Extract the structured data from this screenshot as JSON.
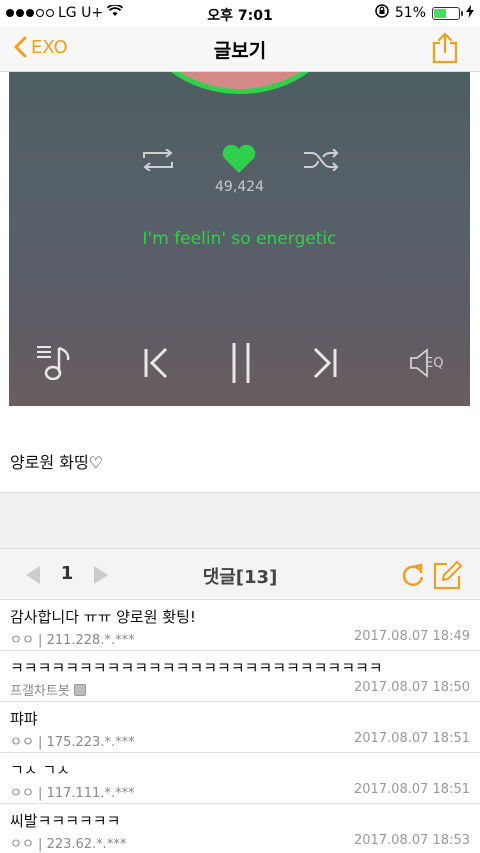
{
  "status_bar": {
    "carrier": "LG U+",
    "time": "오후 7:01",
    "battery": "51%",
    "battery_level": 0.51
  },
  "nav": {
    "back_label": "EXO",
    "title": "글보기"
  },
  "player": {
    "like_count": "49,424",
    "lyric": "I'm feelin' so energetic",
    "eq_label": "EQ"
  },
  "post": {
    "text": "양로원 화띵♡"
  },
  "comments_header": {
    "page": "1",
    "title": "댓글[13]"
  },
  "comments": [
    {
      "text": "감사합니다 ㅠㅠ 양로원 홧팅!",
      "author": "ㅇㅇ | 211.228.*.***",
      "date": "2017.08.07 18:49",
      "badge": false
    },
    {
      "text": "ㅋㅋㅋㅋㅋㅋㅋㅋㅋㅋㅋㅋㅋㅋㅋㅋㅋㅋㅋㅋㅋㅋㅋㅋㅋㅋㅋ",
      "author": "프갤차트봇",
      "date": "2017.08.07 18:50",
      "badge": true
    },
    {
      "text": "퍄퍄",
      "author": "ㅇㅇ | 175.223.*.***",
      "date": "2017.08.07 18:51",
      "badge": false
    },
    {
      "text": "ㄱㅅ ㄱㅅ",
      "author": "ㅇㅇ | 117.111.*.***",
      "date": "2017.08.07 18:51",
      "badge": false
    },
    {
      "text": "씨발ㅋㅋㅋㅋㅋㅋ",
      "author": "ㅇㅇ | 223.62.*.***",
      "date": "2017.08.07 18:53",
      "badge": false
    }
  ],
  "colors": {
    "accent": "#f0a020",
    "lyric_green": "#2fd04b",
    "heart_green": "#2fd04b"
  }
}
